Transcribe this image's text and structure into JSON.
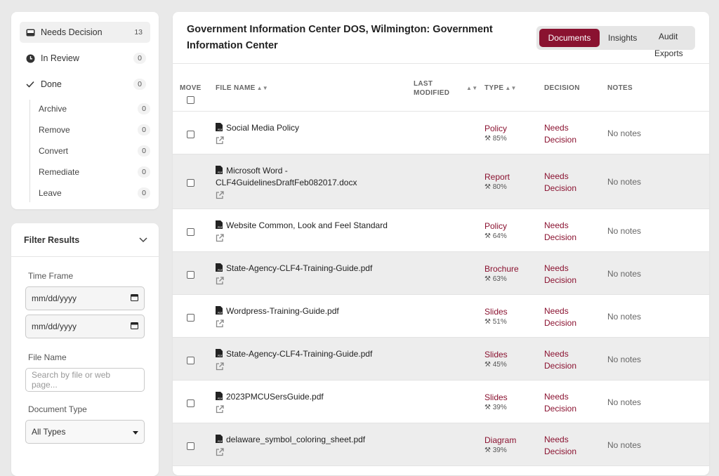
{
  "status": {
    "items": [
      {
        "label": "Needs Decision",
        "count": "13"
      },
      {
        "label": "In Review",
        "count": "0"
      },
      {
        "label": "Done",
        "count": "0"
      }
    ],
    "sub_items": [
      {
        "label": "Archive",
        "count": "0"
      },
      {
        "label": "Remove",
        "count": "0"
      },
      {
        "label": "Convert",
        "count": "0"
      },
      {
        "label": "Remediate",
        "count": "0"
      },
      {
        "label": "Leave",
        "count": "0"
      }
    ]
  },
  "filter": {
    "title": "Filter Results",
    "time_frame_label": "Time Frame",
    "date_placeholder": "mm/dd/yyyy",
    "file_name_label": "File Name",
    "search_placeholder": "Search by file or web page...",
    "doc_type_label": "Document Type",
    "doc_type_value": "All Types"
  },
  "main": {
    "title": "Government Information Center DOS, Wilmington: Government Information Center",
    "tabs": [
      "Documents",
      "Insights",
      "Audit",
      "Exports"
    ],
    "accent": "#8a1230"
  },
  "table": {
    "headers": {
      "move": "MOVE",
      "file_name": "FILE NAME",
      "last_modified": "LAST MODIFIED",
      "type": "TYPE",
      "decision": "DECISION",
      "notes": "NOTES"
    },
    "rows": [
      {
        "name": "Social Media Policy",
        "type": "Policy",
        "confidence": "85%",
        "decision": "Needs Decision",
        "notes": "No notes"
      },
      {
        "name": "Microsoft Word - CLF4GuidelinesDraftFeb082017.docx",
        "type": "Report",
        "confidence": "80%",
        "decision": "Needs Decision",
        "notes": "No notes"
      },
      {
        "name": "Website Common, Look and Feel Standard",
        "type": "Policy",
        "confidence": "64%",
        "decision": "Needs Decision",
        "notes": "No notes"
      },
      {
        "name": "State-Agency-CLF4-Training-Guide.pdf",
        "type": "Brochure",
        "confidence": "63%",
        "decision": "Needs Decision",
        "notes": "No notes"
      },
      {
        "name": "Wordpress-Training-Guide.pdf",
        "type": "Slides",
        "confidence": "51%",
        "decision": "Needs Decision",
        "notes": "No notes"
      },
      {
        "name": "State-Agency-CLF4-Training-Guide.pdf",
        "type": "Slides",
        "confidence": "45%",
        "decision": "Needs Decision",
        "notes": "No notes"
      },
      {
        "name": "2023PMCUSersGuide.pdf",
        "type": "Slides",
        "confidence": "39%",
        "decision": "Needs Decision",
        "notes": "No notes"
      },
      {
        "name": "delaware_symbol_coloring_sheet.pdf",
        "type": "Diagram",
        "confidence": "39%",
        "decision": "Needs Decision",
        "notes": "No notes"
      }
    ]
  }
}
